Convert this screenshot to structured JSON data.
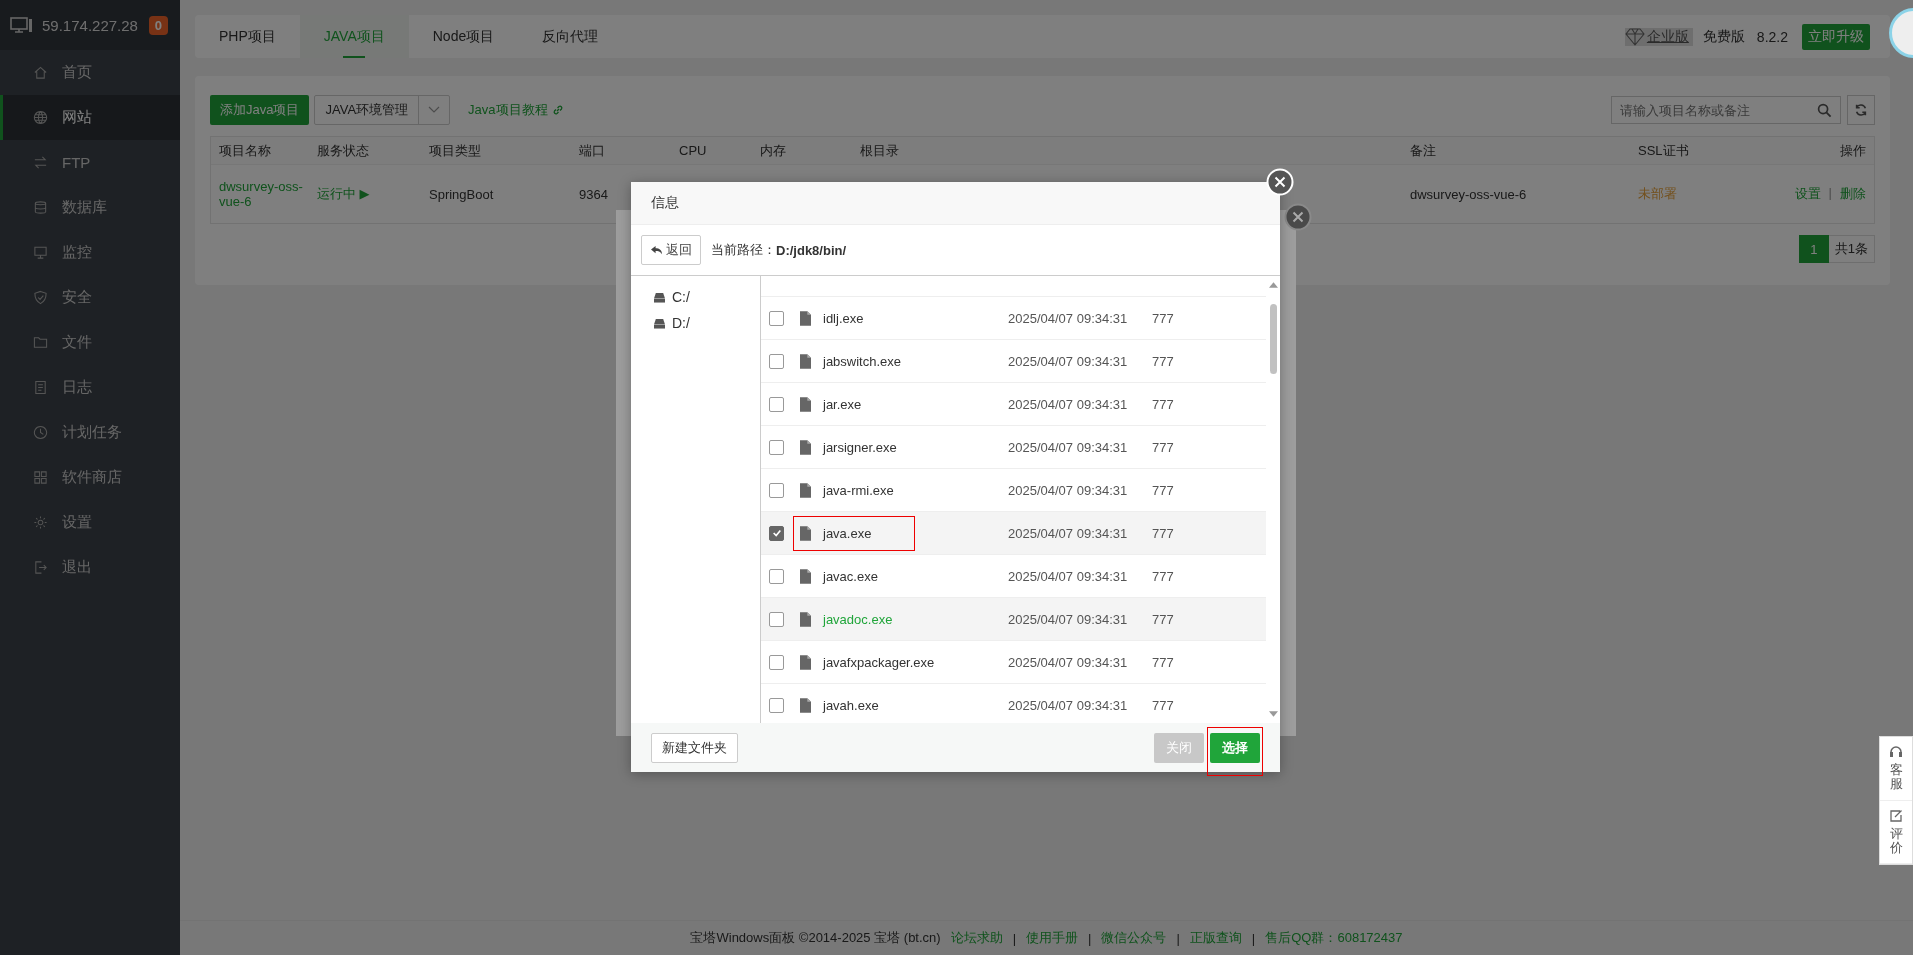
{
  "sidebar": {
    "host": "59.174.227.28",
    "badge": "0",
    "items": [
      {
        "label": "首页",
        "selected": false
      },
      {
        "label": "网站",
        "selected": true
      },
      {
        "label": "FTP",
        "selected": false
      },
      {
        "label": "数据库",
        "selected": false
      },
      {
        "label": "监控",
        "selected": false
      },
      {
        "label": "安全",
        "selected": false
      },
      {
        "label": "文件",
        "selected": false
      },
      {
        "label": "日志",
        "selected": false
      },
      {
        "label": "计划任务",
        "selected": false
      },
      {
        "label": "软件商店",
        "selected": false
      },
      {
        "label": "设置",
        "selected": false
      },
      {
        "label": "退出",
        "selected": false
      }
    ]
  },
  "tabs": [
    {
      "label": "PHP项目",
      "selected": false
    },
    {
      "label": "JAVA项目",
      "selected": true
    },
    {
      "label": "Node项目",
      "selected": false
    },
    {
      "label": "反向代理",
      "selected": false
    }
  ],
  "edition": {
    "enterprise": "企业版",
    "free": "免费版",
    "version": "8.2.2",
    "upgrade": "立即升级"
  },
  "toolbar": {
    "add": "添加Java项目",
    "env": "JAVA环境管理",
    "tutorial": "Java项目教程",
    "search": {
      "placeholder": "请输入项目名称或备注"
    }
  },
  "table": {
    "columns": [
      "项目名称",
      "服务状态",
      "项目类型",
      "端口",
      "CPU",
      "内存",
      "根目录",
      "备注",
      "SSL证书",
      "操作"
    ],
    "rows": [
      {
        "name": "dwsurvey-oss-vue-6",
        "status": "运行中 ▶",
        "type": "SpringBoot",
        "port": "9364",
        "remark": "dwsurvey-oss-vue-6",
        "ssl": "未部署",
        "actions": [
          "设置",
          "删除"
        ],
        "separator": "|"
      }
    ]
  },
  "pagination": {
    "pages": [
      {
        "label": "1",
        "selected": true
      }
    ],
    "total": "共1条"
  },
  "footer": {
    "copyright": "宝塔Windows面板 ©2014-2025 宝塔 (bt.cn)",
    "links": [
      "论坛求助",
      "使用手册",
      "微信公众号",
      "正版查询",
      "售后QQ群：608172437"
    ],
    "separator": "|"
  },
  "side_tools": [
    "客服",
    "评价"
  ],
  "dialog": {
    "title": "信息",
    "back": "返回",
    "path_label": "当前路径：",
    "path": "D:/jdk8/bin/",
    "drives": [
      "C:/",
      "D:/"
    ],
    "files": [
      {
        "name": "idlj.exe",
        "date": "2025/04/07 09:34:31",
        "perms": "777",
        "checked": false,
        "hovered": false,
        "annotated": false
      },
      {
        "name": "jabswitch.exe",
        "date": "2025/04/07 09:34:31",
        "perms": "777",
        "checked": false,
        "hovered": false,
        "annotated": false
      },
      {
        "name": "jar.exe",
        "date": "2025/04/07 09:34:31",
        "perms": "777",
        "checked": false,
        "hovered": false,
        "annotated": false
      },
      {
        "name": "jarsigner.exe",
        "date": "2025/04/07 09:34:31",
        "perms": "777",
        "checked": false,
        "hovered": false,
        "annotated": false
      },
      {
        "name": "java-rmi.exe",
        "date": "2025/04/07 09:34:31",
        "perms": "777",
        "checked": false,
        "hovered": false,
        "annotated": false
      },
      {
        "name": "java.exe",
        "date": "2025/04/07 09:34:31",
        "perms": "777",
        "checked": true,
        "hovered": false,
        "annotated": true
      },
      {
        "name": "javac.exe",
        "date": "2025/04/07 09:34:31",
        "perms": "777",
        "checked": false,
        "hovered": false,
        "annotated": false
      },
      {
        "name": "javadoc.exe",
        "date": "2025/04/07 09:34:31",
        "perms": "777",
        "checked": false,
        "hovered": true,
        "annotated": false
      },
      {
        "name": "javafxpackager.exe",
        "date": "2025/04/07 09:34:31",
        "perms": "777",
        "checked": false,
        "hovered": false,
        "annotated": false
      },
      {
        "name": "javah.exe",
        "date": "2025/04/07 09:34:31",
        "perms": "777",
        "checked": false,
        "hovered": false,
        "annotated": false
      }
    ],
    "buttons": [
      {
        "label": "新建文件夹",
        "kind": "plain",
        "disabled": false,
        "annotated": false
      },
      {
        "label": "关闭",
        "kind": "primary",
        "disabled": true,
        "annotated": false
      },
      {
        "label": "选择",
        "kind": "primary",
        "disabled": false,
        "annotated": true
      }
    ]
  }
}
